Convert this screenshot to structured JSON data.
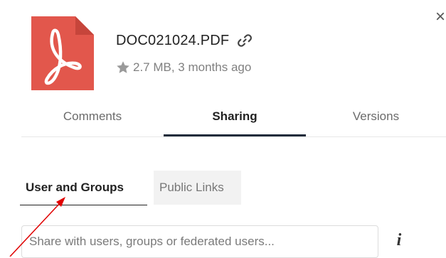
{
  "header": {
    "file_name": "DOC021024.PDF",
    "meta": "2.7 MB, 3 months ago",
    "close_label": "×",
    "icon": "pdf-file-icon",
    "icon_color": "#e2574c"
  },
  "tabs": {
    "items": [
      {
        "label": "Comments",
        "active": false
      },
      {
        "label": "Sharing",
        "active": true
      },
      {
        "label": "Versions",
        "active": false
      }
    ]
  },
  "sharing": {
    "subtabs": [
      {
        "label": "User and Groups",
        "active": true
      },
      {
        "label": "Public Links",
        "active": false
      }
    ],
    "input_placeholder": "Share with users, groups or federated users...",
    "input_value": "",
    "info_label": "i"
  },
  "annotation": {
    "color": "#e00000"
  }
}
